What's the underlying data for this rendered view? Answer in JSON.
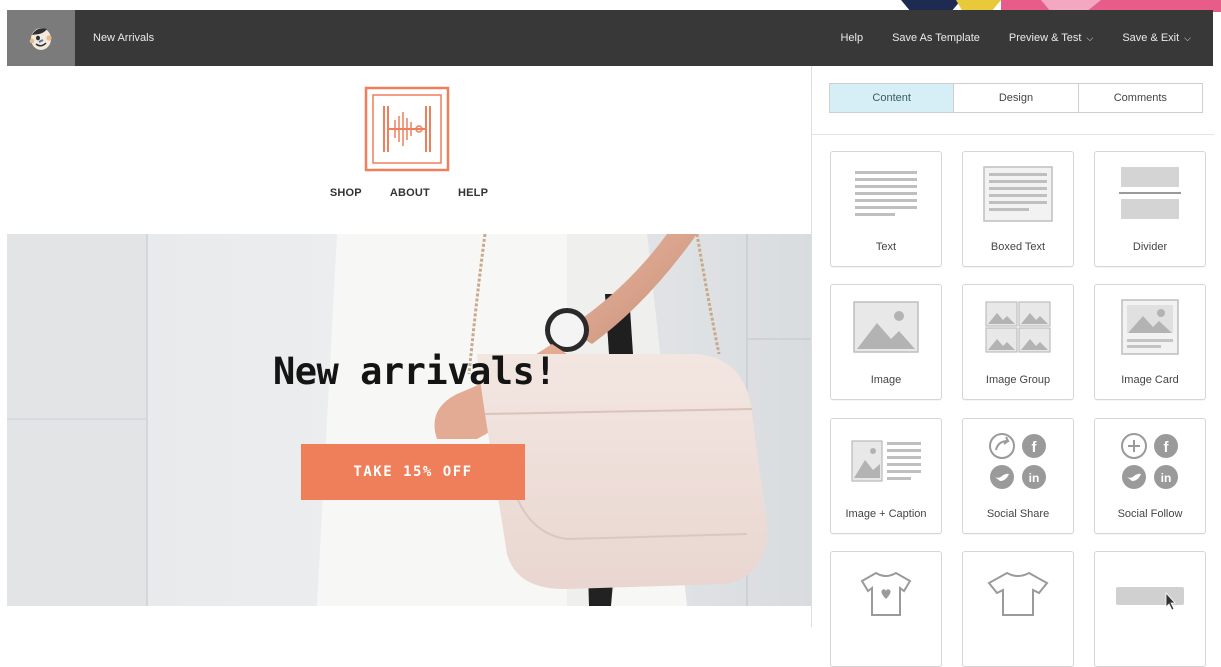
{
  "topbar": {
    "title": "New Arrivals",
    "help": "Help",
    "save_template": "Save As Template",
    "preview": "Preview & Test",
    "save_exit": "Save & Exit"
  },
  "email": {
    "nav": [
      "SHOP",
      "ABOUT",
      "HELP"
    ],
    "hero_title": "New arrivals!",
    "cta_label": "TAKE 15% OFF",
    "brand_color": "#ef7f5b"
  },
  "panel": {
    "tabs": [
      {
        "label": "Content",
        "active": true
      },
      {
        "label": "Design",
        "active": false
      },
      {
        "label": "Comments",
        "active": false
      }
    ],
    "blocks": [
      {
        "label": "Text",
        "icon": "text-block-icon"
      },
      {
        "label": "Boxed Text",
        "icon": "boxed-text-icon"
      },
      {
        "label": "Divider",
        "icon": "divider-icon"
      },
      {
        "label": "Image",
        "icon": "image-icon"
      },
      {
        "label": "Image Group",
        "icon": "image-group-icon"
      },
      {
        "label": "Image Card",
        "icon": "image-card-icon"
      },
      {
        "label": "Image + Caption",
        "icon": "image-caption-icon"
      },
      {
        "label": "Social Share",
        "icon": "social-share-icon"
      },
      {
        "label": "Social Follow",
        "icon": "social-follow-icon"
      },
      {
        "label": "",
        "icon": "product-icon"
      },
      {
        "label": "",
        "icon": "product-alt-icon"
      },
      {
        "label": "",
        "icon": "button-block-icon"
      }
    ]
  },
  "colors": {
    "topbar_bg": "#383838",
    "active_tab_bg": "#d6eef5",
    "cta_bg": "#ef7f5b"
  }
}
